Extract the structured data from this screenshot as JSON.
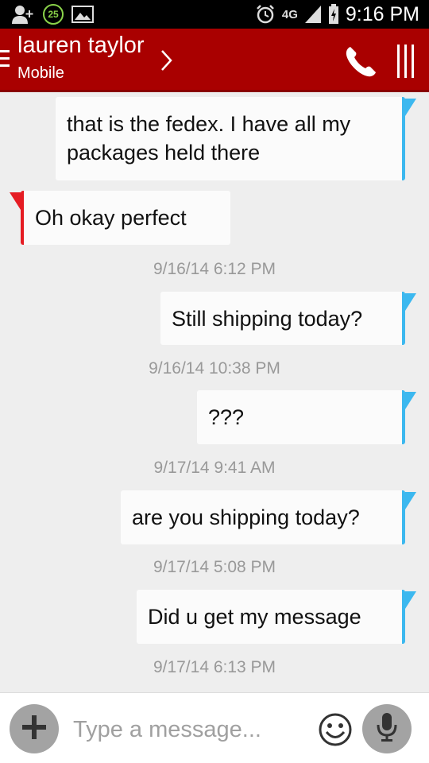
{
  "status_bar": {
    "notification_count": "25",
    "network": "4G",
    "time": "9:16 PM",
    "icons": [
      "add-contact-icon",
      "notification-badge",
      "image-icon",
      "alarm-icon",
      "network-4g-icon",
      "signal-icon",
      "battery-charging-icon"
    ]
  },
  "header": {
    "contact_name": "lauren taylor",
    "contact_type": "Mobile",
    "icons": [
      "menu-icon",
      "chevron-right-icon",
      "phone-icon",
      "overflow-icon"
    ],
    "background_color": "#a90000"
  },
  "conversation": {
    "messages": [
      {
        "direction": "out",
        "text_lines": [
          "that is the fedex. I have all my",
          "packages held there"
        ],
        "timestamp": ""
      },
      {
        "direction": "in",
        "text_lines": [
          "Oh okay perfect"
        ],
        "timestamp": "9/16/14 6:12 PM"
      },
      {
        "direction": "out",
        "text_lines": [
          "Still shipping today?"
        ],
        "timestamp": "9/16/14 10:38 PM"
      },
      {
        "direction": "out",
        "text_lines": [
          "???"
        ],
        "timestamp": "9/17/14 9:41 AM"
      },
      {
        "direction": "out",
        "text_lines": [
          "are you shipping today?"
        ],
        "timestamp": "9/17/14 5:08 PM"
      },
      {
        "direction": "out",
        "text_lines": [
          "Did u get my message"
        ],
        "timestamp": "9/17/14 6:13 PM"
      }
    ],
    "outgoing_color": "#3cb8ef",
    "incoming_color": "#e51c23"
  },
  "composer": {
    "placeholder": "Type a message...",
    "icons": [
      "plus-icon",
      "emoji-icon",
      "microphone-icon"
    ]
  }
}
